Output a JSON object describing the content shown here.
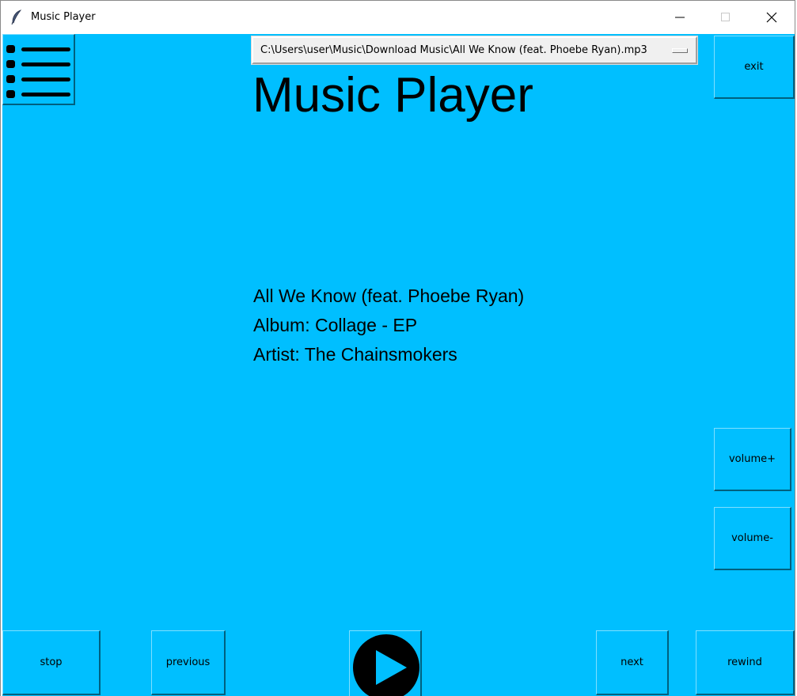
{
  "window": {
    "title": "Music Player"
  },
  "dropdown": {
    "selected": "C:\\Users\\user\\Music\\Download Music\\All We Know (feat. Phoebe Ryan).mp3"
  },
  "header": {
    "title": "Music Player"
  },
  "now_playing": {
    "song": "All We Know (feat. Phoebe Ryan)",
    "album": "Album: Collage - EP",
    "artist": "Artist: The Chainsmokers"
  },
  "buttons": {
    "exit": "exit",
    "volume_up": "volume+",
    "volume_down": "volume-",
    "stop": "stop",
    "previous": "previous",
    "next": "next",
    "rewind": "rewind"
  },
  "icons": {
    "app": "feather-icon",
    "menu": "list-menu-icon",
    "play": "play-icon"
  },
  "colors": {
    "background": "#00bfff",
    "text": "#000000"
  }
}
